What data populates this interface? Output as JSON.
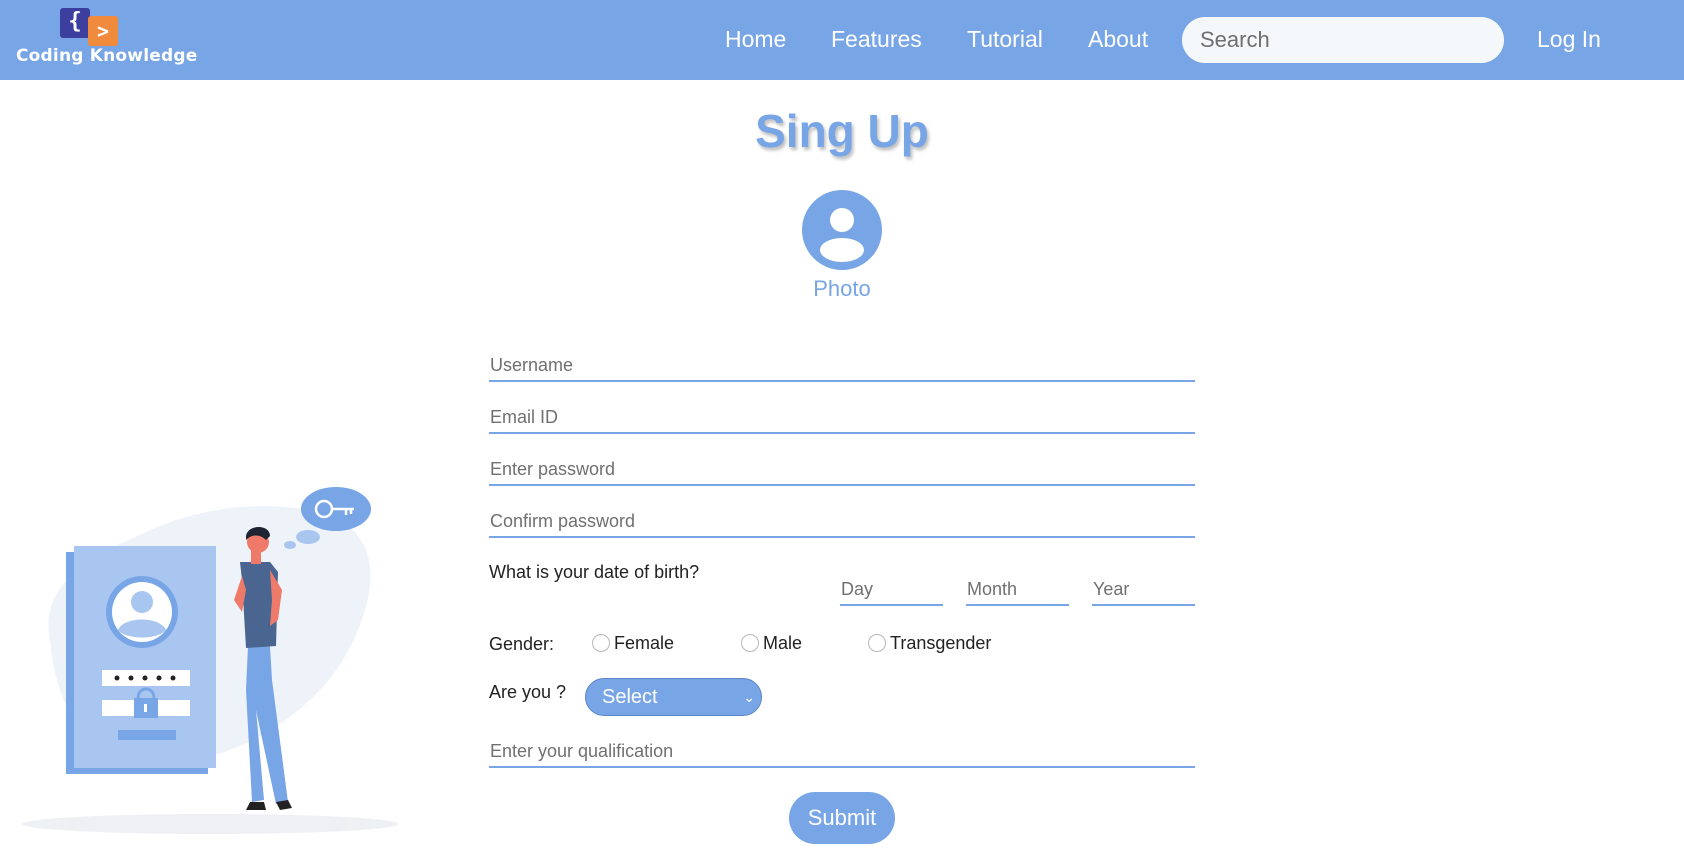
{
  "header": {
    "logo": {
      "left_glyph": "{",
      "right_glyph": ">",
      "text": "Coding Knowledge"
    },
    "nav": [
      "Home",
      "Features",
      "Tutorial",
      "About"
    ],
    "search_placeholder": "Search",
    "login_label": "Log In"
  },
  "form": {
    "title": "Sing Up",
    "photo_label": "Photo",
    "username_placeholder": "Username",
    "email_placeholder": "Email ID",
    "password_placeholder": "Enter password",
    "confirm_placeholder": "Confirm password",
    "dob_label": "What is your date of birth?",
    "day_placeholder": "Day",
    "month_placeholder": "Month",
    "year_placeholder": "Year",
    "gender_label": "Gender:",
    "gender_options": [
      "Female",
      "Male",
      "Transgender"
    ],
    "are_you_label": "Are you ?",
    "select_value": "Select",
    "qualification_placeholder": "Enter your qualification",
    "submit_label": "Submit"
  },
  "colors": {
    "accent": "#78a5e6",
    "dark_blue": "#4a6690",
    "light_blue": "#a9c6f0",
    "bubble": "#eef3fa"
  },
  "icons": {
    "avatar": "user-avatar-icon",
    "select_chevron": "chevron-down-icon",
    "illustration": "login-security-illustration"
  }
}
